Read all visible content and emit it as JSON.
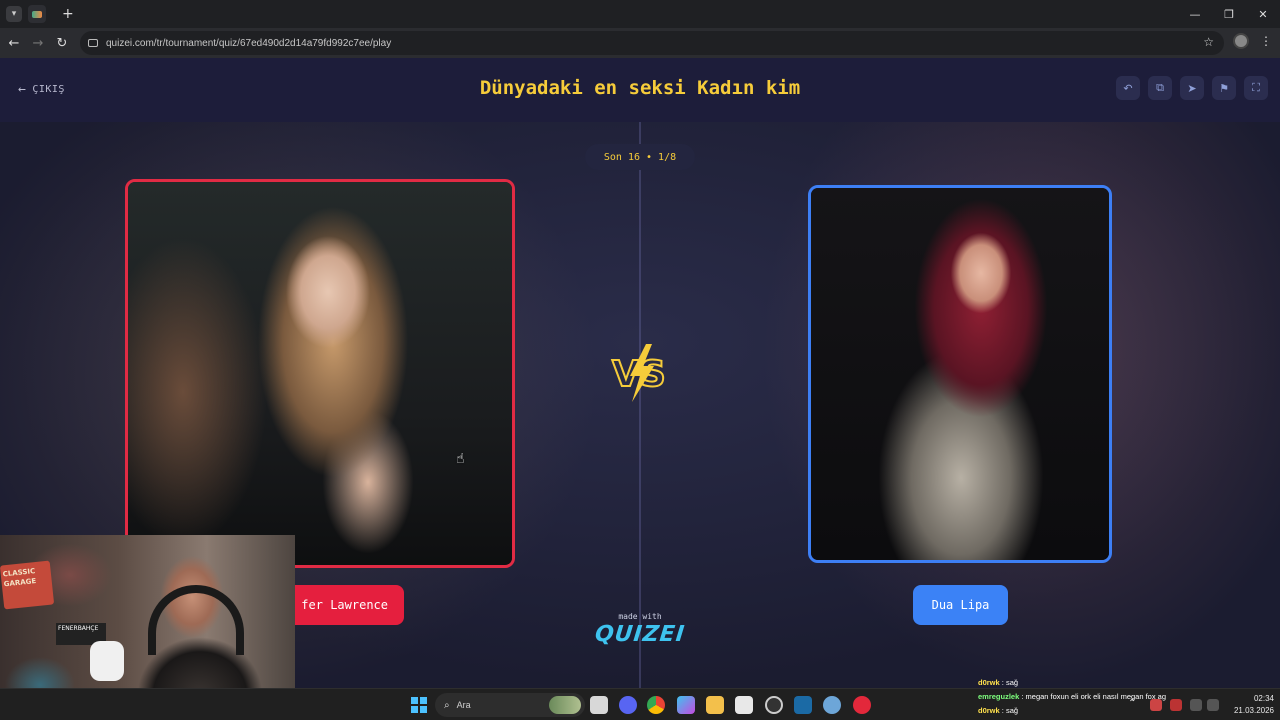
{
  "browser": {
    "url": "quizei.com/tr/tournament/quiz/67ed490d2d14a79fd992c7ee/play",
    "icons": [
      "tab-menu-icon",
      "new-tab-icon",
      "minimize-icon",
      "restore-icon",
      "close-icon",
      "back-icon",
      "forward-icon",
      "reload-icon",
      "site-info-icon",
      "star-icon",
      "extension-icon",
      "menu-kebab-icon"
    ]
  },
  "header": {
    "back_label": "ÇIKIŞ",
    "title": "Dünyadaki en seksi Kadın kim",
    "tools": [
      "undo-icon",
      "copy-icon",
      "share-icon",
      "flag-icon",
      "fullscreen-icon"
    ]
  },
  "round": {
    "label": "Son 16 • 1/8"
  },
  "contestants": {
    "left": {
      "name": "Jennifer Lawrence",
      "visible_name": "fer Lawrence",
      "border_color": "#e12b44",
      "button_color": "#e51f3e"
    },
    "right": {
      "name": "Dua Lipa",
      "border_color": "#3d7ff5",
      "button_color": "#3b82f6"
    }
  },
  "vs_label": "VS",
  "branding": {
    "made_with": "made with",
    "logo": "QUIZEI"
  },
  "webcam": {
    "sign1": "CLASSIC GARAGE",
    "sign2": "FENERBAHÇE"
  },
  "taskbar": {
    "search_placeholder": "Ara",
    "apps": [
      "file-manager-icon",
      "discord-icon",
      "chrome-icon",
      "copilot-icon",
      "folder-icon",
      "store-icon",
      "obs-icon",
      "steam-icon",
      "network-icon",
      "app-icon"
    ],
    "time": "02:34",
    "date": "21.03.2026"
  },
  "chat": [
    {
      "user": "d0rwk",
      "message": " : sağ"
    },
    {
      "user": "emreguzlek",
      "message": " : megan foxun eli ork eli nasıl megan fox ag"
    },
    {
      "user": "d0rwk",
      "message": " : sağ"
    }
  ],
  "colors": {
    "title": "#f6cc3a",
    "logo": "#3ec3ef",
    "page_bg": "#1d1e33"
  }
}
